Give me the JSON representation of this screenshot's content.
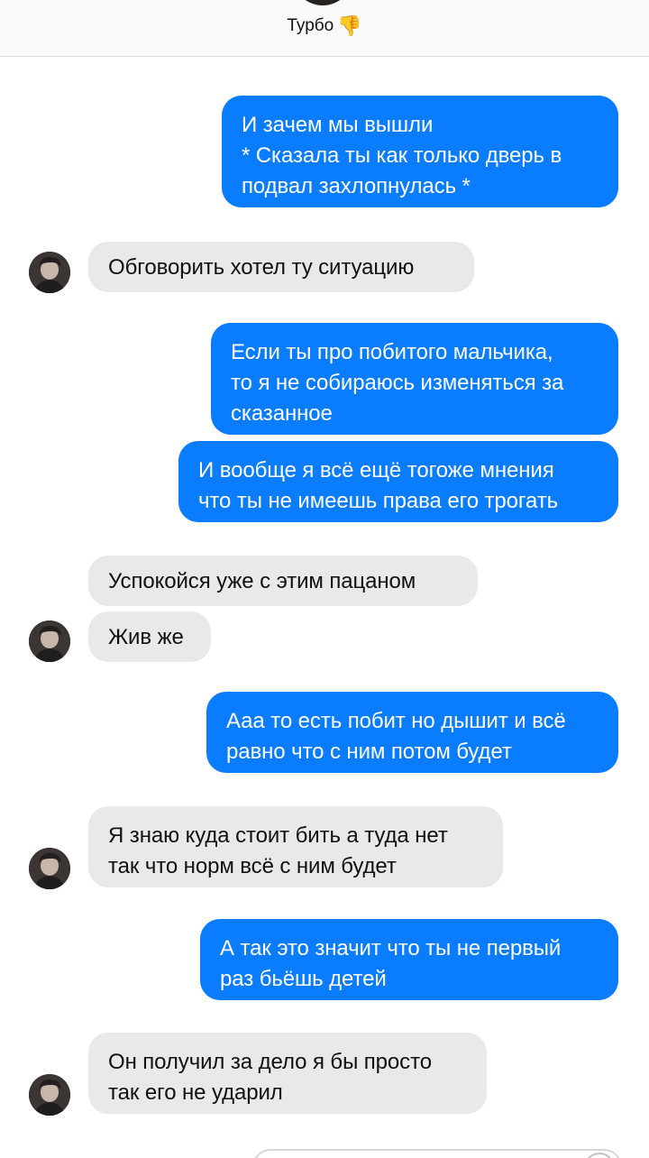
{
  "header": {
    "contact_name": "Турбо",
    "contact_emoji": "👎"
  },
  "messages": [
    {
      "from": "me",
      "text": "И зачем мы вышли\n* Сказала ты как только дверь в\nподвал захлопнулась *"
    },
    {
      "from": "them",
      "text": "Обговорить хотел ту ситуацию"
    },
    {
      "from": "me",
      "text": "Если ты про побитого мальчика,\nто я не собираюсь изменяться за\nсказанное"
    },
    {
      "from": "me",
      "text": "И вообще я всё ещё тогоже мнения\nчто ты не имеешь права его трогать"
    },
    {
      "from": "them",
      "text": "Успокойся уже с этим пацаном"
    },
    {
      "from": "them",
      "text": "Жив же"
    },
    {
      "from": "me",
      "text": "Ааа то есть побит но дышит и всё\nравно что с ним потом будет"
    },
    {
      "from": "them",
      "text": "Я знаю куда стоит бить а туда нет\nтак что норм всё с ним будет"
    },
    {
      "from": "me",
      "text": "А так это значит что ты не первый\nраз бьёшь детей"
    },
    {
      "from": "them",
      "text": "Он получил за дело я бы просто\nтак его не ударил"
    }
  ],
  "colors": {
    "sent_bubble": "#0a7cff",
    "received_bubble": "#e9e9eb",
    "header_bg": "#fafafa"
  },
  "icons": {
    "contact_avatar": "avatar-photo",
    "thumbs_down": "thumbs-down-emoji"
  }
}
